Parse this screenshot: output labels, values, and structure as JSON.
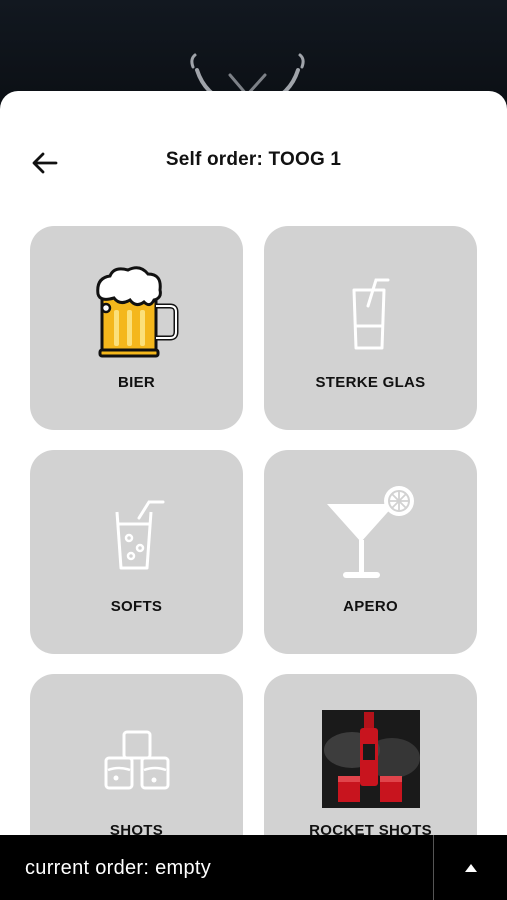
{
  "header": {
    "title": "Self order: TOOG 1"
  },
  "categories": [
    {
      "label": "BIER",
      "icon": "beer-mug-icon"
    },
    {
      "label": "STERKE GLAS",
      "icon": "tall-glass-straw-icon"
    },
    {
      "label": "SOFTS",
      "icon": "soft-drink-glass-icon"
    },
    {
      "label": "APERO",
      "icon": "cocktail-glass-icon"
    },
    {
      "label": "SHOTS",
      "icon": "shot-glasses-icon"
    },
    {
      "label": "ROCKET SHOTS",
      "icon": "rocket-shots-photo"
    }
  ],
  "footer": {
    "order_status": "current order: empty"
  },
  "colors": {
    "tile_bg": "#d2d2d2",
    "footer_bg": "#000000",
    "beer": "#f4b71c"
  }
}
